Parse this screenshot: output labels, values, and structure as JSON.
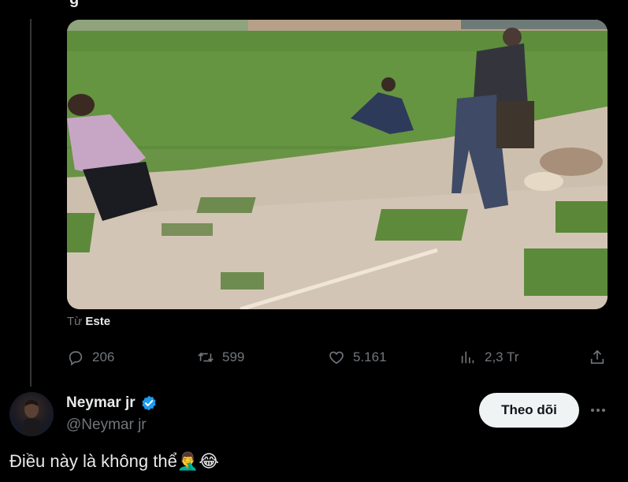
{
  "tweet_top": {
    "partial_text": "g"
  },
  "quoted_tweet": {
    "source_prefix": "Từ",
    "source_name": "Este",
    "replies_count": "206",
    "retweets_count": "599",
    "likes_count": "5.161",
    "views_count": "2,3 Tr"
  },
  "author": {
    "name": "Neymar jr",
    "handle": "@Neymar jr",
    "follow_label": "Theo dõi",
    "verified_color": "#1d9bf0"
  },
  "tweet": {
    "text": "Điều này là không thể🤦‍♂️😂"
  },
  "icons": {
    "reply": "reply-icon",
    "retweet": "retweet-icon",
    "like": "heart-icon",
    "views": "views-icon",
    "share": "share-icon",
    "more": "more-icon"
  }
}
